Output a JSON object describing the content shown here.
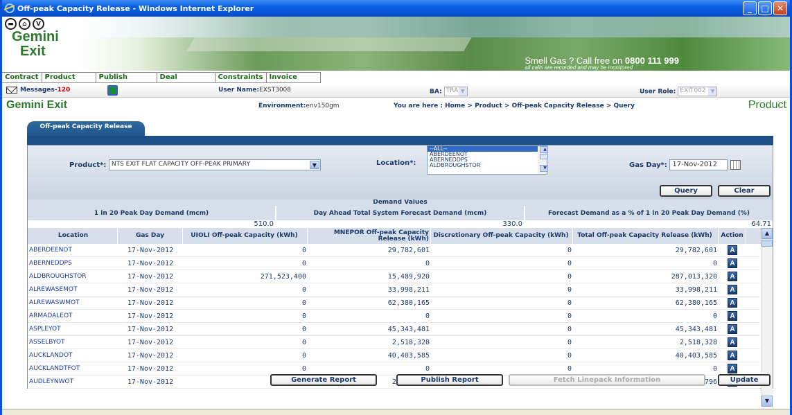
{
  "window": {
    "title": "Off-peak Capacity Release - Windows Internet Explorer"
  },
  "brand": {
    "line1": "Gemini",
    "line2": "Exit",
    "circles": [
      "",
      "",
      "V"
    ]
  },
  "banner": {
    "smell": "Smell Gas ? Call free on",
    "phone": "0800 111 999",
    "note": "all calls are recorded and may be monitored"
  },
  "menu": [
    "Contract",
    "Product",
    "Publish",
    "Deal",
    "Constraints",
    "Invoice"
  ],
  "userbar": {
    "messages_label": "Messages-",
    "messages_count": "120",
    "username_label": "User Name:",
    "username": "EXST3008",
    "ba_label": "BA:",
    "ba_value": "TRA",
    "role_label": "User Role:",
    "role_value": "EXIT002"
  },
  "page": {
    "system": "Gemini Exit",
    "env_label": "Environment:",
    "env": "env150gm",
    "breadcrumb": "You are here : Home > Product > Off-peak Capacity Release > Query",
    "section": "Product",
    "tab": "Off-peak Capacity Release"
  },
  "filters": {
    "product_label": "Product*:",
    "product_value": "NTS EXIT FLAT CAPACITY OFF-PEAK PRIMARY",
    "location_label": "Location*:",
    "location_options": [
      "--ALL--",
      "ABERDEENOT",
      "ABERNEDDPS",
      "ALDBROUGHSTOR"
    ],
    "gasday_label": "Gas Day*:",
    "gasday_value": "17-Nov-2012",
    "query": "Query",
    "clear": "Clear"
  },
  "demand": {
    "title": "Demand Values",
    "h1": "1 in 20 Peak Day Demand (mcm)",
    "h2": "Day Ahead Total System Forecast Demand (mcm)",
    "h3": "Forecast Demand as a % of 1 in 20 Peak Day Demand (%)",
    "v1": "510.0",
    "v2": "330.0",
    "v3": "64.71"
  },
  "table": {
    "headers": [
      "Location",
      "Gas Day",
      "UIOLI Off-peak Capacity (kWh)",
      "MNEPOR Off-peak Capacity Release (kWh)",
      "Discretionary Off-peak Capacity (kWh)",
      "Total Off-peak Capacity Release (kWh)",
      "Action"
    ],
    "rows": [
      [
        "ABERDEENOT",
        "17-Nov-2012",
        "0",
        "29,782,601",
        "0",
        "29,782,601"
      ],
      [
        "ABERNEDDPS",
        "17-Nov-2012",
        "0",
        "0",
        "0",
        "0"
      ],
      [
        "ALDBROUGHSTOR",
        "17-Nov-2012",
        "271,523,400",
        "15,489,920",
        "0",
        "287,013,320"
      ],
      [
        "ALREWASEMOT",
        "17-Nov-2012",
        "0",
        "33,998,211",
        "0",
        "33,998,211"
      ],
      [
        "ALREWASWMOT",
        "17-Nov-2012",
        "0",
        "62,380,165",
        "0",
        "62,380,165"
      ],
      [
        "ARMADALEOT",
        "17-Nov-2012",
        "0",
        "0",
        "0",
        "0"
      ],
      [
        "ASPLEYOT",
        "17-Nov-2012",
        "0",
        "45,343,481",
        "0",
        "45,343,481"
      ],
      [
        "ASSELBYOT",
        "17-Nov-2012",
        "0",
        "2,518,328",
        "0",
        "2,518,328"
      ],
      [
        "AUCKLANDOT",
        "17-Nov-2012",
        "0",
        "40,403,585",
        "0",
        "40,403,585"
      ],
      [
        "AUCKLANDTFOT",
        "17-Nov-2012",
        "0",
        "0",
        "0",
        "0"
      ],
      [
        "AUDLEYNWOT",
        "17-Nov-2012",
        "0",
        "2,732,796",
        "0",
        "2,732,796"
      ]
    ],
    "action_label": "A"
  },
  "buttons": {
    "generate": "Generate Report",
    "publish": "Publish Report",
    "fetch": "Fetch Linepack Information",
    "update": "Update"
  },
  "colors": {
    "accent": "#1b4f86",
    "brand_green": "#2a7a2a",
    "titlebar": "#0a5fe0"
  }
}
